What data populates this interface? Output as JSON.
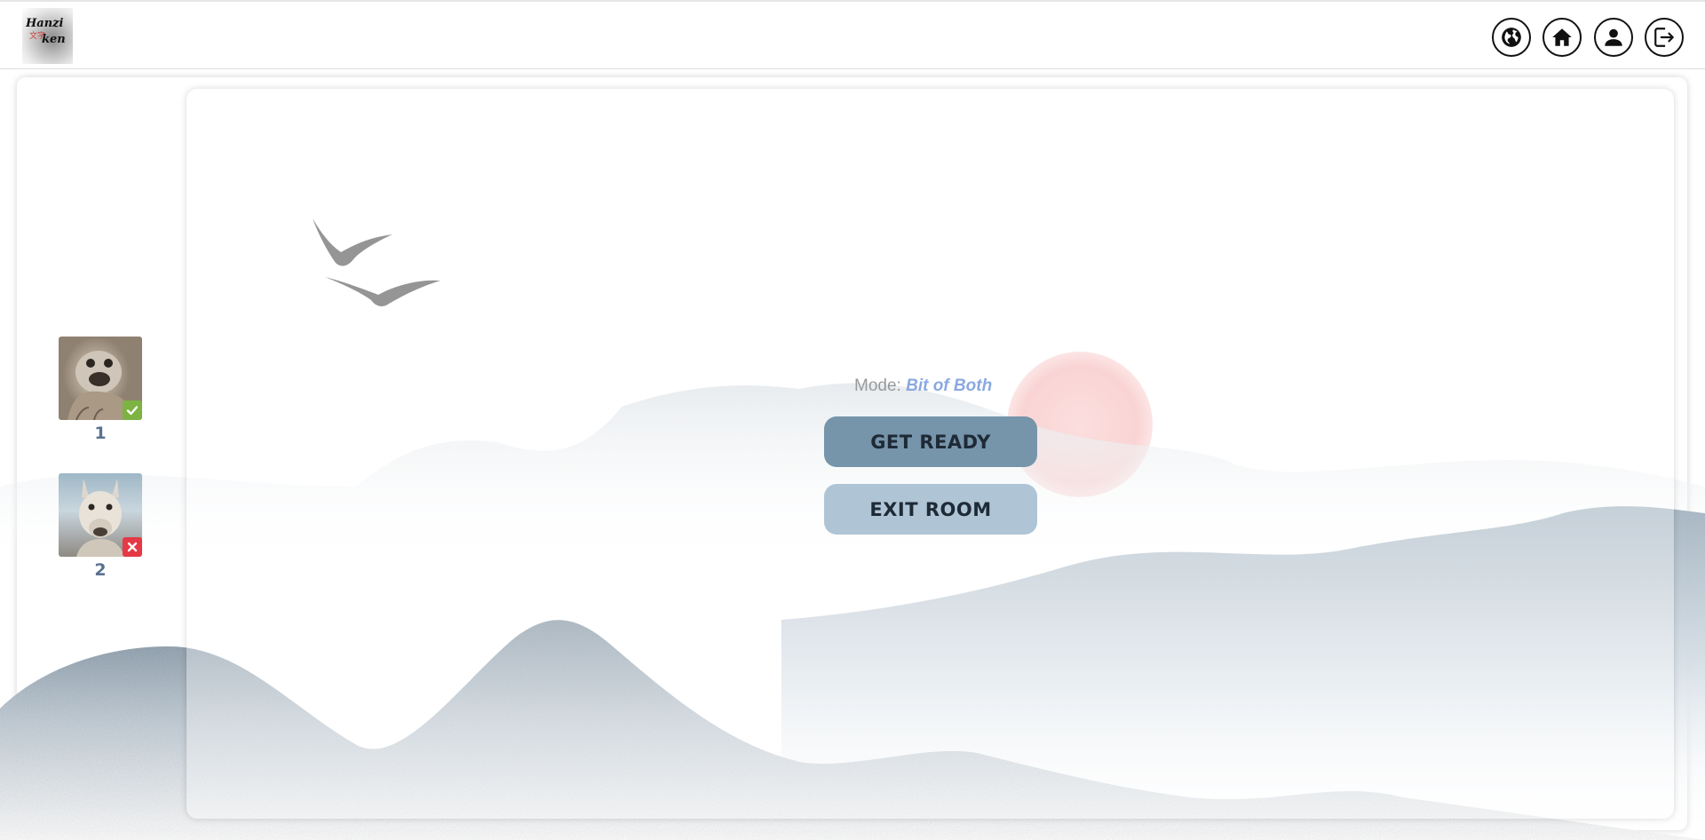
{
  "header": {
    "logo": {
      "name": "hanzi-logo",
      "line1": "Hanzi",
      "line2": "ken",
      "mark": "文字"
    },
    "icons": [
      {
        "name": "globe-icon",
        "label": "language"
      },
      {
        "name": "home-icon",
        "label": "home"
      },
      {
        "name": "user-icon",
        "label": "profile"
      },
      {
        "name": "logout-icon",
        "label": "log out"
      }
    ]
  },
  "players": [
    {
      "label": "1",
      "status": "ready",
      "status_icon": "check-icon",
      "status_color": "#7cb342",
      "avatar": "seal-photo"
    },
    {
      "label": "2",
      "status": "not-ready",
      "status_icon": "close-icon",
      "status_color": "#e53945",
      "avatar": "llama-photo"
    }
  ],
  "room": {
    "mode_label": "Mode:",
    "mode_value": "Bit of Both",
    "ready_button": "GET READY",
    "exit_button": "EXIT ROOM"
  },
  "colors": {
    "mode_value": "#8ba8e0",
    "ready_button_bg": "#7694aa",
    "exit_button_bg": "#afc5d5",
    "sun": "#f7b4b4",
    "mountains": "#6f8597"
  }
}
